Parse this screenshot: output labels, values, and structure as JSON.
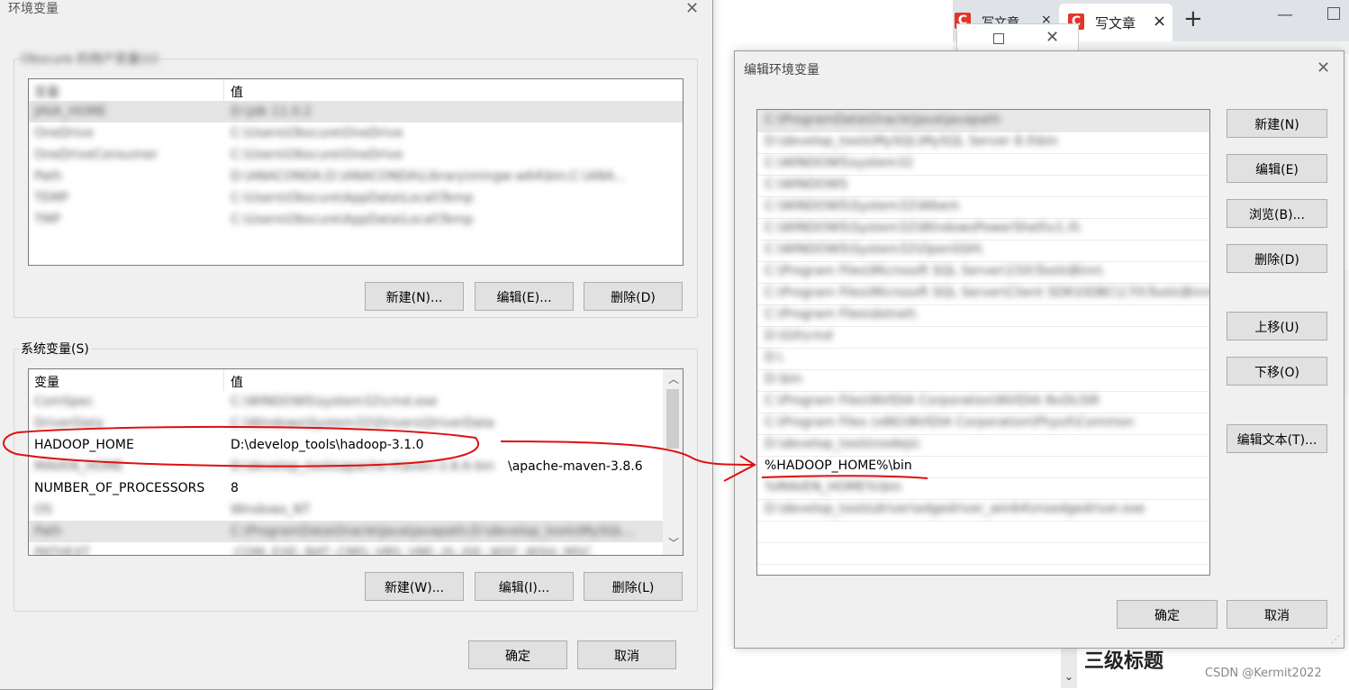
{
  "browser": {
    "tab1_label": "写文章",
    "tab2_label": "写文章",
    "new_tab": "+",
    "logo_letter": "C",
    "heading": "三级标题",
    "watermark": "CSDN @Kermit2022"
  },
  "env_dialog": {
    "title": "环境变量",
    "user_group_label": "Obscure 的用户变量(U)",
    "col_var": "变量",
    "col_val": "值",
    "user_vars": [
      {
        "name": "JAVA_HOME",
        "value": "D:\\jdk 11.0.2"
      },
      {
        "name": "OneDrive",
        "value": "C:\\Users\\Obscure\\OneDrive"
      },
      {
        "name": "OneDriveConsumer",
        "value": "C:\\Users\\Obscure\\OneDrive"
      },
      {
        "name": "Path",
        "value": "D:\\ANACONDA;D:\\ANACONDA\\Library\\mingw-w64\\bin;C:\\ANA..."
      },
      {
        "name": "TEMP",
        "value": "C:\\Users\\Obscure\\AppData\\Local\\Temp"
      },
      {
        "name": "TMP",
        "value": "C:\\Users\\Obscure\\AppData\\Local\\Temp"
      }
    ],
    "user_new": "新建(N)...",
    "user_edit": "编辑(E)...",
    "user_delete": "删除(D)",
    "sys_group_label": "系统变量(S)",
    "sys_col_var": "变量",
    "sys_col_val": "值",
    "sys_vars": [
      {
        "name": "ComSpec",
        "value": "C:\\WINDOWS\\system32\\cmd.exe",
        "clear": false
      },
      {
        "name": "DriverData",
        "value": "C:\\Windows\\System32\\Drivers\\DriverData",
        "clear": false
      },
      {
        "name": "HADOOP_HOME",
        "value": "D:\\develop_tools\\hadoop-3.1.0",
        "clear": true
      },
      {
        "name": "MAVEN_HOME",
        "value": "\\apache-maven-3.8.6",
        "value_blur": "D:\\develop_tools\\apache-maven-3.8.6-bin",
        "clear": false
      },
      {
        "name": "NUMBER_OF_PROCESSORS",
        "value": "8",
        "clear": false
      },
      {
        "name": "OS",
        "value": "Windows_NT",
        "clear": false
      },
      {
        "name": "Path",
        "value": "C:\\ProgramData\\Oracle\\Java\\javapath;D:\\develop_tools\\MySQL...",
        "clear": false
      },
      {
        "name": "PATHEXT",
        "value": ".COM;.EXE;.BAT;.CMD;.VBS;.VBE;.JS;.JSE;.WSF;.WSH;.MSC",
        "clear": false
      }
    ],
    "sys_new": "新建(W)...",
    "sys_edit": "编辑(I)...",
    "sys_delete": "删除(L)",
    "ok": "确定",
    "cancel": "取消"
  },
  "edit_dialog": {
    "title": "编辑环境变量",
    "entries": [
      "C:\\ProgramData\\Oracle\\Java\\javapath",
      "D:\\develop_tools\\MySQL\\MySQL Server 8.0\\bin",
      "C:\\WINDOWS\\system32",
      "C:\\WINDOWS",
      "C:\\WINDOWS\\System32\\Wbem",
      "C:\\WINDOWS\\System32\\WindowsPowerShell\\v1.0\\",
      "C:\\WINDOWS\\System32\\OpenSSH\\",
      "C:\\Program Files\\Microsoft SQL Server\\150\\Tools\\Binn\\",
      "C:\\Program Files\\Microsoft SQL Server\\Client SDK\\ODBC\\170\\Tools\\Binn\\",
      "C:\\Program Files\\dotnet\\",
      "D:\\Git\\cmd",
      "D:\\",
      "D:\\bin",
      "C:\\Program Files\\NVIDIA Corporation\\NVIDIA NvDLISR",
      "C:\\Program Files (x86)\\NVIDIA Corporation\\PhysX\\Common",
      "D:\\develop_tools\\nodejs\\",
      "%HADOOP_HOME%\\bin",
      "%MAVEN_HOME%\\bin",
      "D:\\develop_tools\\driver\\edgedriver_win64\\msedgedriver.exe"
    ],
    "highlight_index": 16,
    "btn_new": "新建(N)",
    "btn_edit": "编辑(E)",
    "btn_browse": "浏览(B)...",
    "btn_delete": "删除(D)",
    "btn_up": "上移(U)",
    "btn_down": "下移(O)",
    "btn_edit_text": "编辑文本(T)...",
    "ok": "确定",
    "cancel": "取消"
  },
  "colors": {
    "annotation_red": "#e01010",
    "dialog_bg": "#f0f0f0",
    "button_bg": "#e1e1e1",
    "csdn_red": "#e2362a"
  }
}
